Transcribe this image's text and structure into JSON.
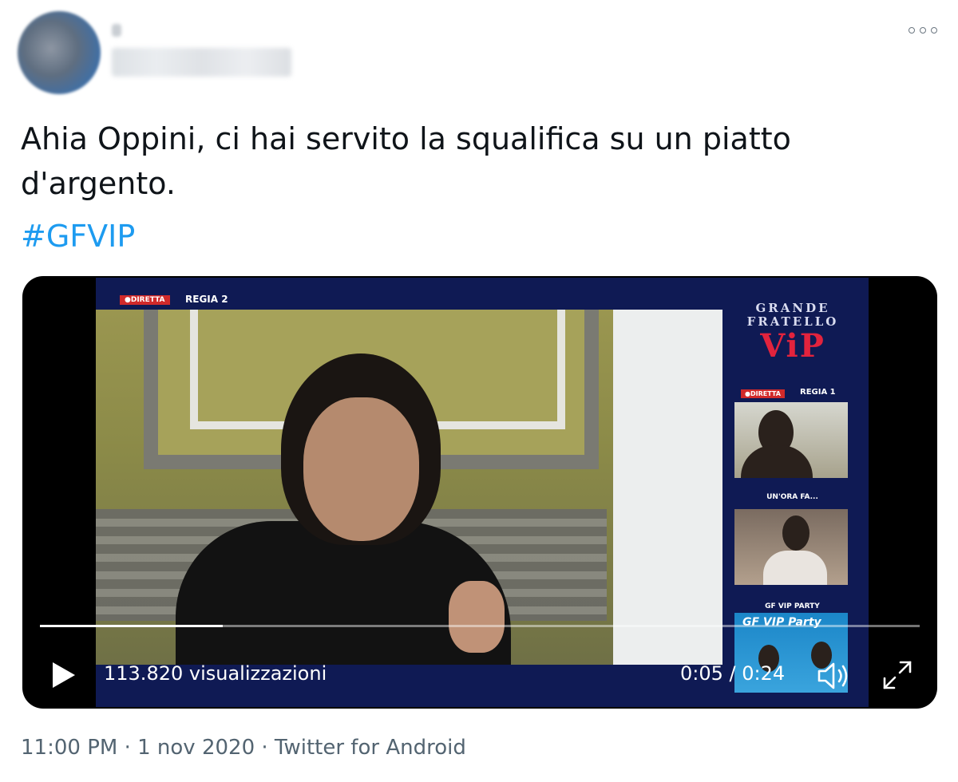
{
  "tweet": {
    "text": "Ahia Oppini, ci hai servito la squalifica su un piatto d'argento.",
    "hashtag": "#GFVIP",
    "timestamp": "11:00 PM · 1 nov 2020 · Twitter for Android",
    "more_icon": "ellipsis-icon"
  },
  "video": {
    "views": "113.820 visualizzazioni",
    "time": "0:05 / 0:24",
    "progress": 0.208,
    "play_icon": "play-icon",
    "volume_icon": "volume-icon",
    "fullscreen_icon": "fullscreen-icon",
    "overlay": {
      "live_main": "●DIRETTA",
      "regia_main": "REGIA 2",
      "logo_line1": "GRANDE",
      "logo_line2": "FRATELLO",
      "logo_vip": "ViP",
      "live_side": "●DIRETTA",
      "regia_side": "REGIA 1",
      "label_hour": "UN'ORA FA...",
      "label_party": "GF VIP PARTY",
      "party_title": "GF VIP Party"
    }
  },
  "colors": {
    "hashtag": "#1d9bf0",
    "meta": "#536471",
    "vip_red": "#e2233d"
  }
}
